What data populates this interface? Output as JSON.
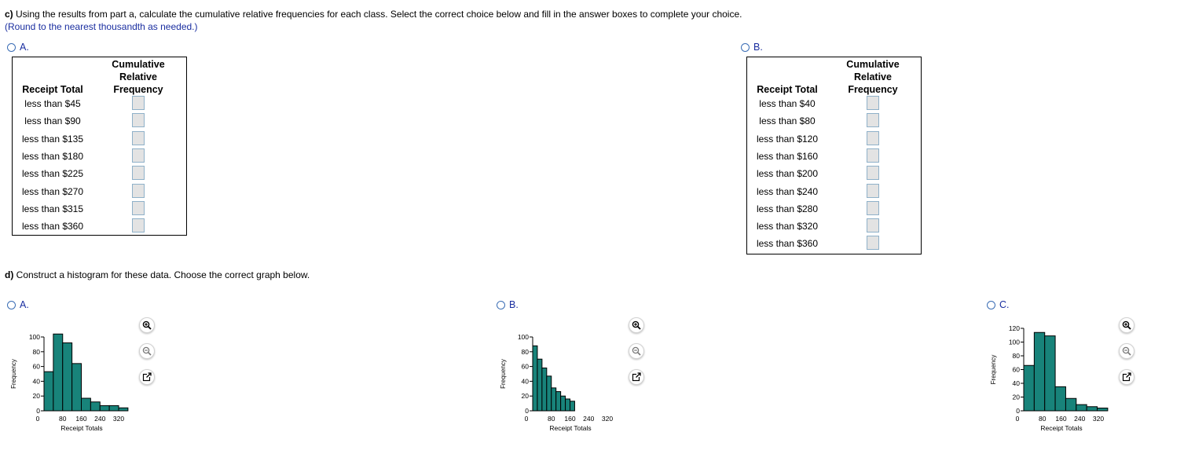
{
  "part_c": {
    "label": "c)",
    "prompt": "Using the results from part a, calculate the cumulative relative frequencies for each class. Select the correct choice below and fill in the answer boxes to complete your choice.",
    "round_note": "(Round to the nearest thousandth as needed.)",
    "option_a": {
      "letter": "A.",
      "col1_header": "Receipt Total",
      "col2_header": [
        "Cumulative",
        "Relative",
        "Frequency"
      ],
      "rows": [
        "less than $45",
        "less than $90",
        "less than $135",
        "less than $180",
        "less than $225",
        "less than $270",
        "less than $315",
        "less than $360"
      ]
    },
    "option_b": {
      "letter": "B.",
      "col1_header": "Receipt Total",
      "col2_header": [
        "Cumulative",
        "Relative",
        "Frequency"
      ],
      "rows": [
        "less than $40",
        "less than $80",
        "less than $120",
        "less than $160",
        "less than $200",
        "less than $240",
        "less than $280",
        "less than $320",
        "less than $360"
      ]
    }
  },
  "part_d": {
    "label": "d)",
    "prompt": "Construct a histogram for these data. Choose the correct graph below.",
    "options": [
      {
        "letter": "A."
      },
      {
        "letter": "B."
      },
      {
        "letter": "C."
      }
    ],
    "controls": [
      "zoom-in-icon",
      "zoom-out-icon",
      "expand-icon"
    ]
  },
  "chart_data": [
    {
      "type": "bar",
      "option": "A",
      "xlabel": "Receipt Totals",
      "ylabel": "Frequency",
      "bin_width": 40,
      "x_start": 0,
      "values": [
        53,
        104,
        92,
        64,
        17,
        12,
        7,
        7,
        4
      ],
      "xticks": [
        "0",
        "80",
        "160",
        "240",
        "320"
      ],
      "xtick_values": [
        0,
        80,
        160,
        240,
        320
      ],
      "yticks": [
        "0",
        "20",
        "40",
        "60",
        "80",
        "100"
      ],
      "ylim": [
        0,
        100
      ],
      "colors": {
        "bar": "#18837a",
        "edge": "#000000"
      }
    },
    {
      "type": "bar",
      "option": "B",
      "xlabel": "Receipt Totals",
      "ylabel": "Frequency",
      "bin_width": 20,
      "x_start": 0,
      "values": [
        88,
        70,
        58,
        47,
        31,
        26,
        20,
        16,
        13
      ],
      "xticks": [
        "0",
        "80",
        "160",
        "240",
        "320"
      ],
      "xtick_values": [
        0,
        80,
        160,
        240,
        320
      ],
      "yticks": [
        "0",
        "20",
        "40",
        "60",
        "80",
        "100"
      ],
      "ylim": [
        0,
        100
      ],
      "colors": {
        "bar": "#18837a",
        "edge": "#000000"
      }
    },
    {
      "type": "bar",
      "option": "C",
      "xlabel": "Receipt Totals",
      "ylabel": "Frequency",
      "bin_width": 45,
      "x_start": 0,
      "values": [
        66,
        114,
        109,
        35,
        18,
        9,
        6,
        4
      ],
      "xticks": [
        "0",
        "80",
        "160",
        "240",
        "320"
      ],
      "xtick_values": [
        0,
        80,
        160,
        240,
        320
      ],
      "yticks": [
        "0",
        "20",
        "40",
        "60",
        "80",
        "100",
        "120"
      ],
      "ylim": [
        0,
        120
      ],
      "colors": {
        "bar": "#18837a",
        "edge": "#000000"
      }
    }
  ]
}
